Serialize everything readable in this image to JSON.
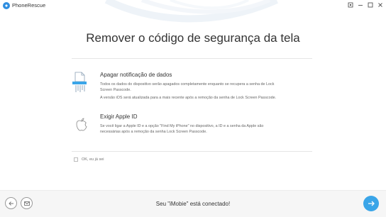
{
  "window": {
    "app_title": "PhoneRescue",
    "controls": [
      "restore-icon",
      "minimize-icon",
      "maximize-icon",
      "close-icon"
    ]
  },
  "main": {
    "title": "Remover o código de segurança da tela",
    "options": [
      {
        "icon": "data-shredder-icon",
        "heading": "Apagar notificação de dados",
        "desc_lines": [
          "Todos os dados do dispositivo serão apagados completamente enquanto se recupera a senha de Lock",
          "Screen Passcode.",
          "A versão iOS será atualizada para a mais recente após a remoção da senha de Lock Screen Passcode."
        ]
      },
      {
        "icon": "apple-icon",
        "heading": "Exigir Apple ID",
        "desc_lines": [
          "Se você ligar a Apple ID e a opção \"Find My iPhone\" no dispositivo, a ID e a senha da Apple são",
          "necessárias após a remoção da senha Lock Screen Passcode."
        ]
      }
    ],
    "confirm_label": "OK, eu já sei",
    "confirm_checked": false
  },
  "footer": {
    "status": "Seu \"iMobie\" está conectado!",
    "icons": [
      "back-arrow-icon",
      "mail-icon",
      "next-arrow-icon"
    ]
  },
  "colors": {
    "accent": "#3aa5e8",
    "logo": "#2f8ee0",
    "divider": "#e5e5e5"
  }
}
